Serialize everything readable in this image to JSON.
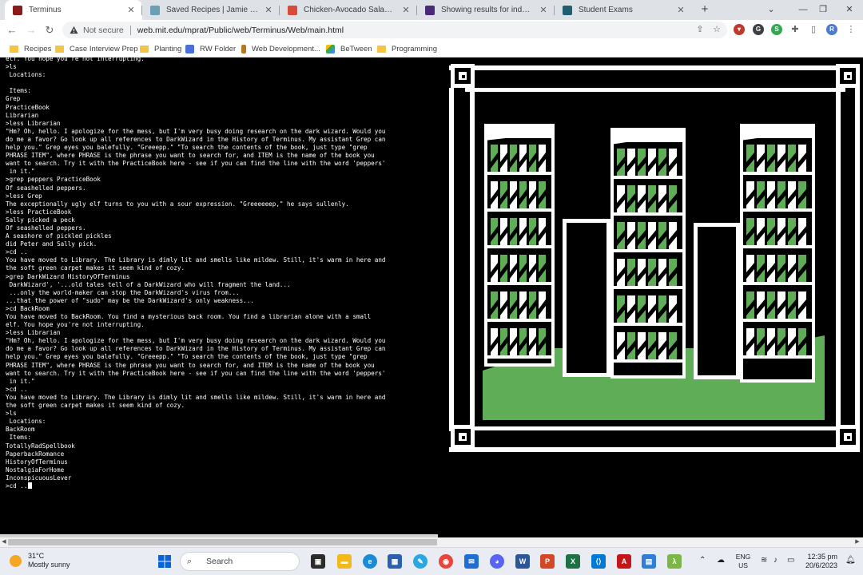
{
  "browser": {
    "tabs": [
      {
        "title": "Terminus",
        "favicon_color": "#8b1a1a",
        "active": true
      },
      {
        "title": "Saved Recipes | Jamie Oliver",
        "favicon_color": "#6a9fb5",
        "active": false
      },
      {
        "title": "Chicken-Avocado Salad Sandwich",
        "favicon_color": "#d84a3a",
        "active": false
      },
      {
        "title": "Showing results for index.html - I",
        "favicon_color": "#4b2a7a",
        "active": false
      },
      {
        "title": "Student Exams",
        "favicon_color": "#1f5f6e",
        "active": false
      }
    ],
    "security_label": "Not secure",
    "url": "web.mit.edu/mprat/Public/web/Terminus/Web/main.html",
    "profile_initial": "R",
    "bookmarks": [
      {
        "label": "Recipes",
        "type": "folder"
      },
      {
        "label": "Case Interview Prep",
        "type": "folder"
      },
      {
        "label": "Planting",
        "type": "folder"
      },
      {
        "label": "RW Folder",
        "type": "doc"
      },
      {
        "label": "Web Development...",
        "type": "site"
      },
      {
        "label": "BeTween",
        "type": "drive"
      },
      {
        "label": "Programming",
        "type": "folder"
      }
    ]
  },
  "terminal": {
    "lines": [
      "elf. You hope you're not interrupting.",
      ">ls",
      " Locations:",
      "",
      " Items:",
      "Grep",
      "PracticeBook",
      "Librarian",
      ">less Librarian",
      "\"Hm? Oh, hello. I apologize for the mess, but I'm very busy doing research on the dark wizard. Would you",
      "do me a favor? Go look up all references to DarkWizard in the History of Terminus. My assistant Grep can",
      "help you.\" Grep eyes you balefully. \"Greeepp.\" \"To search the contents of the book, just type \"grep",
      "PHRASE ITEM\", where PHRASE is the phrase you want to search for, and ITEM is the name of the book you",
      "want to search. Try it with the PracticeBook here - see if you can find the line with the word 'peppers'",
      " in it.\"",
      ">grep peppers PracticeBook",
      "Of seashelled peppers.",
      ">less Grep",
      "The exceptionally ugly elf turns to you with a sour expression. \"Greeeeeep,\" he says sullenly.",
      ">less PracticeBook",
      "Sally picked a peck",
      "Of seashelled peppers.",
      "A seashore of pickled pickles",
      "did Peter and Sally pick.",
      ">cd ..",
      "You have moved to Library. The Library is dimly lit and smells like mildew. Still, it's warm in here and",
      "the soft green carpet makes it seem kind of cozy.",
      ">grep DarkWizard HistoryOfTerminus",
      " DarkWizard', '...old tales tell of a DarkWizard who will fragment the land...",
      " ...only the world-maker can stop the DarkWizard's virus from...",
      "...that the power of \"sudo\" may be the DarkWizard's only weakness...",
      ">cd BackRoom",
      "You have moved to BackRoom. You find a mysterious back room. You find a librarian alone with a small",
      "elf. You hope you're not interrupting.",
      ">less Librarian",
      "\"Hm? Oh, hello. I apologize for the mess, but I'm very busy doing research on the dark wizard. Would you",
      "do me a favor? Go look up all references to DarkWizard in the History of Terminus. My assistant Grep can",
      "help you.\" Grep eyes you balefully. \"Greeepp.\" \"To search the contents of the book, just type \"grep",
      "PHRASE ITEM\", where PHRASE is the phrase you want to search for, and ITEM is the name of the book you",
      "want to search. Try it with the PracticeBook here - see if you can find the line with the word 'peppers'",
      " in it.\"",
      ">cd ..",
      "You have moved to Library. The Library is dimly lit and smells like mildew. Still, it's warm in here and",
      "the soft green carpet makes it seem kind of cozy.",
      ">ls",
      " Locations:",
      "BackRoom",
      " Items:",
      "TotallyRadSpellbook",
      "PaperbackRomance",
      "HistoryOfTerminus",
      "NostalgiaForHome",
      "InconspicuousLever"
    ],
    "prompt_input": ">cd .."
  },
  "scene": {
    "green": "#5fad56",
    "white": "#ffffff",
    "black": "#000000"
  },
  "taskbar": {
    "weather_temp": "31°C",
    "weather_desc": "Mostly sunny",
    "search_label": "Search",
    "lang_top": "ENG",
    "lang_bottom": "US",
    "time": "12:35 pm",
    "date": "20/6/2023"
  }
}
